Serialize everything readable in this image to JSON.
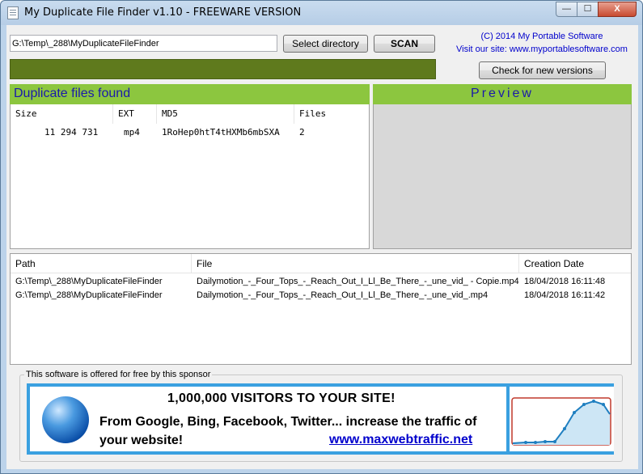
{
  "window": {
    "title": "My Duplicate File Finder v1.10 - FREEWARE VERSION",
    "min_glyph": "—",
    "max_glyph": "☐",
    "close_glyph": "X"
  },
  "toolbar": {
    "path_value": "G:\\Temp\\_288\\MyDuplicateFileFinder",
    "select_directory_label": "Select directory",
    "scan_label": "SCAN",
    "check_versions_label": "Check for new versions",
    "copyright_line1": "(C) 2014 My Portable Software",
    "copyright_line2": "Visit our site: www.myportablesoftware.com"
  },
  "duplicates": {
    "header": "Duplicate files found",
    "columns": [
      "Size",
      "EXT",
      "MD5",
      "Files"
    ],
    "rows": [
      {
        "size": "11 294 731",
        "ext": "mp4",
        "md5": "1RoHep0htT4tHXMb6mbSXA",
        "files": "2"
      }
    ]
  },
  "preview": {
    "header": "Preview"
  },
  "files": {
    "columns": [
      "Path",
      "File",
      "Creation Date"
    ],
    "rows": [
      {
        "path": "G:\\Temp\\_288\\MyDuplicateFileFinder",
        "file": "Dailymotion_-_Four_Tops_-_Reach_Out_I_Ll_Be_There_-_une_vid_ - Copie.mp4",
        "date": "18/04/2018 16:11:48"
      },
      {
        "path": "G:\\Temp\\_288\\MyDuplicateFileFinder",
        "file": "Dailymotion_-_Four_Tops_-_Reach_Out_I_Ll_Be_There_-_une_vid_.mp4",
        "date": "18/04/2018 16:11:42"
      }
    ]
  },
  "sponsor": {
    "label": "This software is offered for free by this sponsor",
    "headline": "1,000,000 VISITORS TO YOUR SITE!",
    "body": "From Google, Bing, Facebook, Twitter... increase the traffic of your website!",
    "link": "www.maxwebtraffic.net"
  },
  "colors": {
    "accent_green": "#8cc63f",
    "progress_green": "#5f7a1d",
    "header_text_blue": "#1a1aaa",
    "link_blue": "#0000cc",
    "ad_border": "#3aa0e0"
  }
}
